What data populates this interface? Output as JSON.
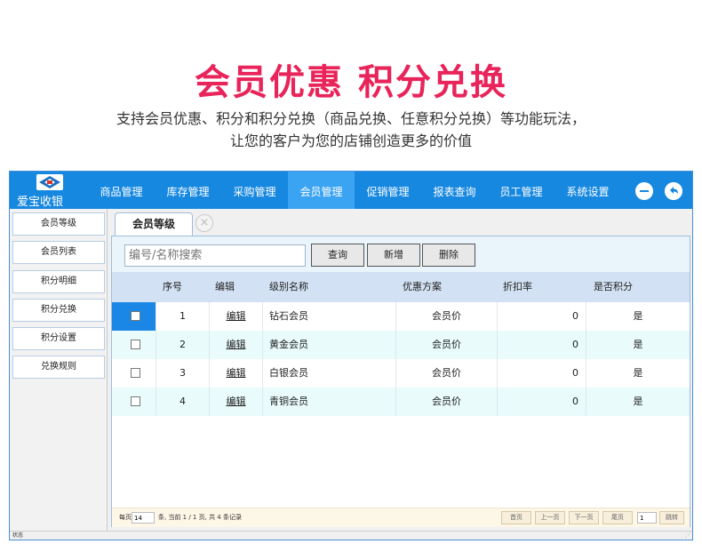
{
  "hero": {
    "title": "会员优惠 积分兑换",
    "subtitle_line1": "支持会员优惠、积分和积分兑换（商品兑换、任意积分兑换）等功能玩法，",
    "subtitle_line2": "让您的客户为您的店铺创造更多的价值"
  },
  "app": {
    "name": "爱宝收银",
    "accent_color": "#1788e0",
    "active_menu_color": "#3aa3f2",
    "menu": [
      "商品管理",
      "库存管理",
      "采购管理",
      "会员管理",
      "促销管理",
      "报表查询",
      "员工管理",
      "系统设置"
    ],
    "active_menu": "会员管理",
    "window_buttons": [
      "minimize-icon",
      "back-icon"
    ],
    "sidebar": [
      "会员等级",
      "会员列表",
      "积分明细",
      "积分兑换",
      "积分设置",
      "兑换规则"
    ],
    "tab": {
      "label": "会员等级",
      "close_icon": "close-icon",
      "close_glyph": "×"
    },
    "search": {
      "placeholder": "编号/名称搜索"
    },
    "toolbar": {
      "query": "查询",
      "add": "新增",
      "delete": "删除"
    },
    "table": {
      "headers": [
        "序号",
        "编辑",
        "级别名称",
        "优惠方案",
        "折扣率",
        "是否积分"
      ],
      "rows": [
        {
          "no": "1",
          "edit": "编辑",
          "name": "钻石会员",
          "plan": "会员价",
          "rate": "0",
          "points": "是"
        },
        {
          "no": "2",
          "edit": "编辑",
          "name": "黄金会员",
          "plan": "会员价",
          "rate": "0",
          "points": "是"
        },
        {
          "no": "3",
          "edit": "编辑",
          "name": "白银会员",
          "plan": "会员价",
          "rate": "0",
          "points": "是"
        },
        {
          "no": "4",
          "edit": "编辑",
          "name": "青铜会员",
          "plan": "会员价",
          "rate": "0",
          "points": "是"
        }
      ]
    },
    "pager": {
      "per_page_label": "每页",
      "per_page_value": "14",
      "info": "条, 当前 1 / 1 页, 共 4 条记录",
      "first": "首页",
      "prev": "上一页",
      "next": "下一页",
      "last": "尾页",
      "page_value": "1",
      "go": "跳转"
    },
    "status": "状态"
  }
}
